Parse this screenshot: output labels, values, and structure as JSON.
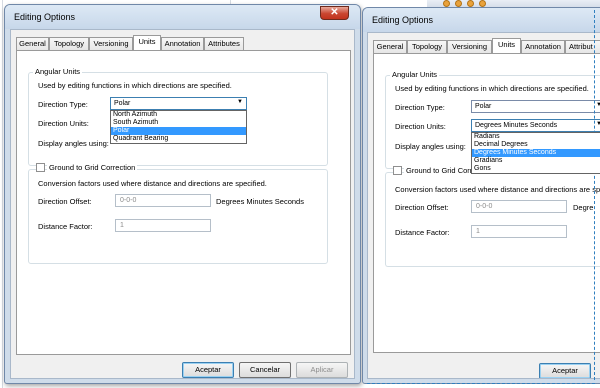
{
  "left_dialog": {
    "title": "Editing Options",
    "close_glyph": "✕",
    "tabs": [
      "General",
      "Topology",
      "Versioning",
      "Units",
      "Annotation",
      "Attributes"
    ],
    "selected_tab": "Units",
    "angular_units": {
      "group_title": "Angular Units",
      "description": "Used by editing functions in which directions are specified.",
      "direction_type_label": "Direction Type:",
      "direction_type_value": "Polar",
      "direction_type_options": [
        "North Azimuth",
        "South Azimuth",
        "Polar",
        "Quadrant Bearing"
      ],
      "direction_type_highlighted": "Polar",
      "direction_units_label": "Direction Units:",
      "display_angles_label": "Display angles using:"
    },
    "ground_to_grid": {
      "checkbox_label": "Ground to Grid Correction",
      "description": "Conversion factors used where distance and directions are specified.",
      "direction_offset_label": "Direction Offset:",
      "direction_offset_value": "0-0-0",
      "direction_offset_unit": "Degrees Minutes Seconds",
      "distance_factor_label": "Distance Factor:",
      "distance_factor_value": "1"
    },
    "buttons": {
      "ok": "Aceptar",
      "cancel": "Cancelar",
      "apply": "Aplicar"
    }
  },
  "right_dialog": {
    "title": "Editing Options",
    "tabs": [
      "General",
      "Topology",
      "Versioning",
      "Units",
      "Annotation",
      "Attribut"
    ],
    "selected_tab": "Units",
    "angular_units": {
      "group_title": "Angular Units",
      "description": "Used by editing functions in which directions are specified.",
      "direction_type_label": "Direction Type:",
      "direction_type_value": "Polar",
      "direction_units_label": "Direction Units:",
      "direction_units_value": "Degrees Minutes Seconds",
      "direction_units_options": [
        "Radians",
        "Decimal Degrees",
        "Degrees Minutes Seconds",
        "Gradians",
        "Gons"
      ],
      "direction_units_highlighted": "Degrees Minutes Seconds",
      "display_angles_label": "Display angles using:"
    },
    "ground_to_grid": {
      "checkbox_label": "Ground to Grid Corre",
      "description": "Conversion factors used where distance and directions are sp",
      "direction_offset_label": "Direction Offset:",
      "direction_offset_value": "0-0-0",
      "direction_offset_unit": "Degre",
      "distance_factor_label": "Distance Factor:",
      "distance_factor_value": "1"
    },
    "buttons": {
      "ok": "Aceptar"
    }
  },
  "colors": {
    "frame": "#cfdcea",
    "selection": "#3399ff",
    "close_button": "#c94630"
  },
  "icons": {
    "close": "close-icon",
    "dropdown": "chevron-down-icon",
    "toolbar": "toolbar-icon"
  }
}
